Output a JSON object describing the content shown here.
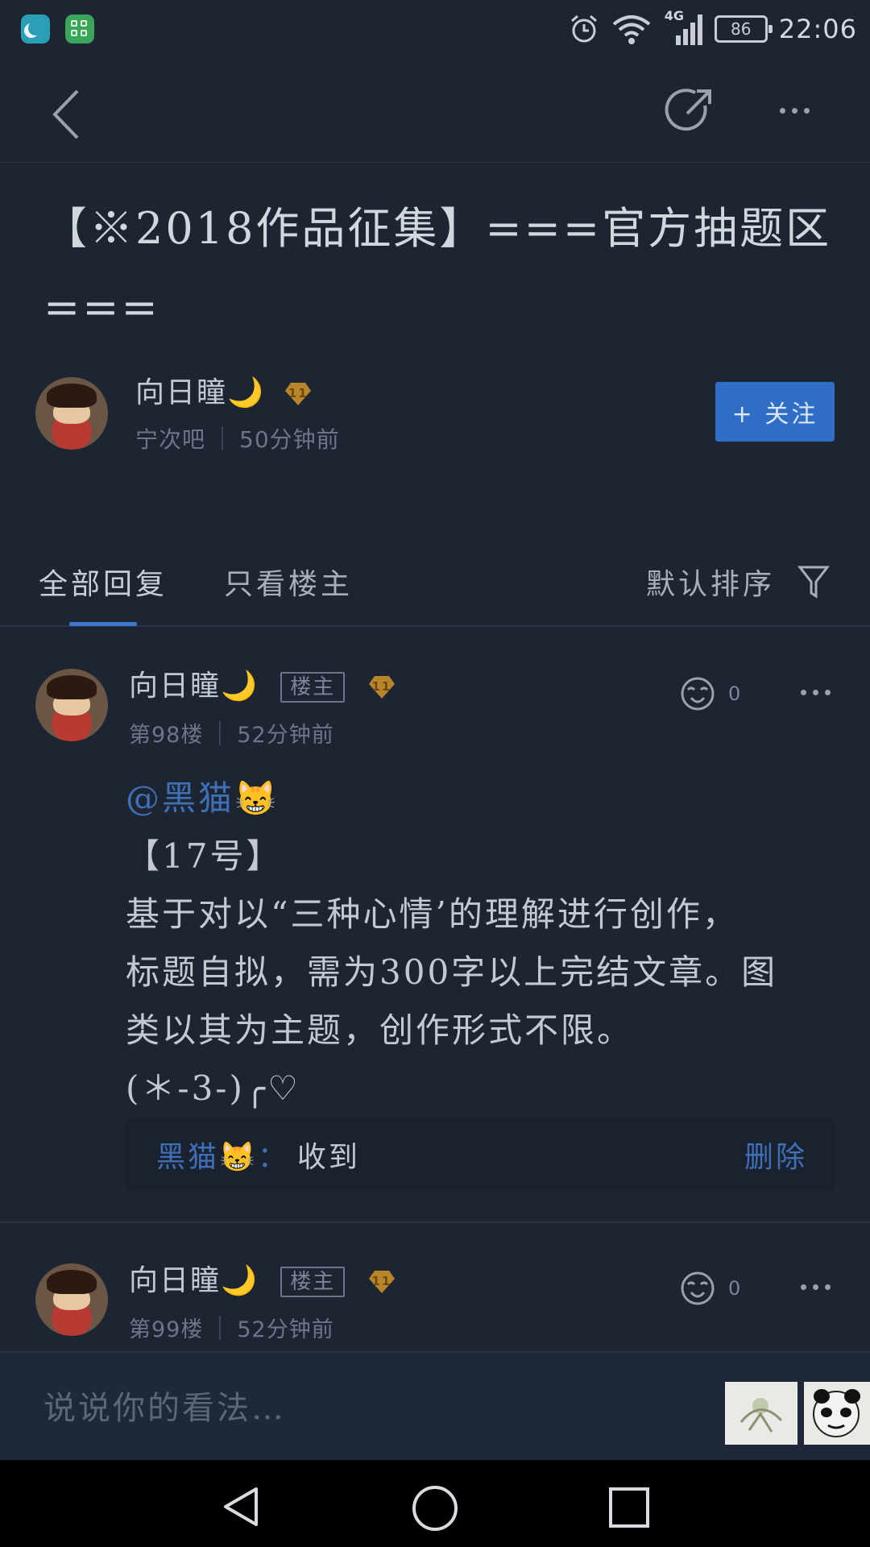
{
  "status_bar": {
    "network": "4G",
    "battery": "86",
    "time": "22:06"
  },
  "post": {
    "title": "【※2018作品征集】===官方抽题区===",
    "author": {
      "name": "向日瞳",
      "emoji": "🌙",
      "level": "11",
      "forum": "宁次吧",
      "time": "50分钟前"
    },
    "follow_label": "+ 关注"
  },
  "tabs": {
    "all": "全部回复",
    "owner_only": "只看楼主",
    "sort": "默认排序"
  },
  "floors": [
    {
      "name": "向日瞳",
      "emoji": "🌙",
      "owner_badge": "楼主",
      "level": "11",
      "floor": "第98楼",
      "time": "52分钟前",
      "likes": "0",
      "mention": "@黑猫😸",
      "lines": [
        "【17号】",
        "基于对以“三种心情’的理解进行创作，",
        "标题自拟，需为300字以上完结文章。图",
        "类以其为主题，创作形式不限。",
        "(＊-3-)╭♡"
      ],
      "reply": {
        "user": "黑猫😸：",
        "text": "收到",
        "delete": "删除"
      }
    },
    {
      "name": "向日瞳",
      "emoji": "🌙",
      "owner_badge": "楼主",
      "level": "11",
      "floor": "第99楼",
      "time": "52分钟前",
      "likes": "0"
    }
  ],
  "input": {
    "placeholder": "说说你的看法…"
  },
  "icons": [
    "back-icon",
    "share-icon",
    "more-icon",
    "filter-icon",
    "like-icon",
    "alarm-icon",
    "wifi-icon",
    "signal-icon",
    "battery-icon"
  ]
}
